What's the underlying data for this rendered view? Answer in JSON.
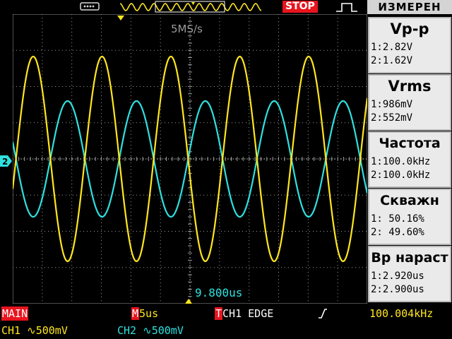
{
  "top": {
    "status": "STOP",
    "icons": [
      "usb-icon",
      "waveform-memory-icon",
      "trigger-pulse-icon"
    ]
  },
  "screen": {
    "sample_rate": "5MS/s",
    "cursor_readout": "9.800us",
    "ch2_marker": "2",
    "colors": {
      "ch1": "#ffe61e",
      "ch2": "#2fe0e0",
      "grid": "#9a9a9a"
    }
  },
  "menu": {
    "title": "ИЗМЕРЕН",
    "items": [
      {
        "name": "Vp-p",
        "ch1": "1:2.82V",
        "ch2": "2:1.62V"
      },
      {
        "name": "Vrms",
        "ch1": "1:986mV",
        "ch2": "2:552mV"
      },
      {
        "name": "Частота",
        "ch1": "1:100.0kHz",
        "ch2": "2:100.0kHz"
      },
      {
        "name": "Скважн",
        "ch1": "1: 50.16%",
        "ch2": "2: 49.60%"
      },
      {
        "name": "Вр нараст",
        "ch1": "1:2.920us",
        "ch2": "2:2.900us"
      }
    ]
  },
  "status": {
    "mode": "MAIN",
    "timebase_tag": "M",
    "timebase": "5us",
    "trigger_tag": "T",
    "trigger": "CH1 EDGE",
    "trigger_freq": "100.004kHz",
    "ch1_scale": "CH1 ∿500mV",
    "ch2_scale": "CH2 ∿500mV"
  }
}
